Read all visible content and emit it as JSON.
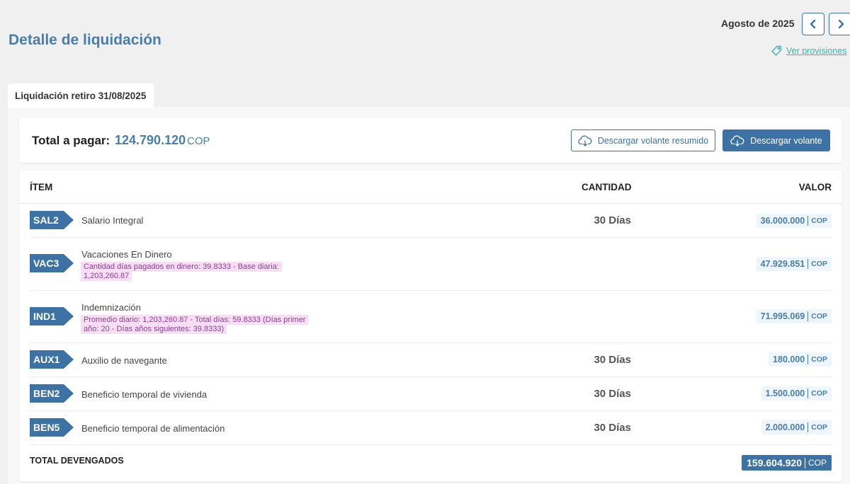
{
  "header": {
    "title": "Detalle de liquidación",
    "period": "Agosto de 2025",
    "provisions_link": "Ver provisiones"
  },
  "tab": {
    "label": "Liquidación retiro 31/08/2025"
  },
  "summary": {
    "total_label": "Total a pagar:",
    "total_amount": "124.790.120",
    "currency": "COP",
    "download_summary_label": "Descargar volante resumido",
    "download_label": "Descargar volante"
  },
  "table": {
    "headers": {
      "item": "ÍTEM",
      "quantity": "CANTIDAD",
      "value": "VALOR"
    },
    "rows": [
      {
        "code": "SAL2",
        "name": "Salario Integral",
        "detail": "",
        "quantity": "30 Días",
        "value": "36.000.000",
        "currency": "COP"
      },
      {
        "code": "VAC3",
        "name": "Vacaciones En Dinero",
        "detail": "Cantidad días pagados en dinero: 39.8333 - Base diaria: 1,203,260.87",
        "quantity": "",
        "value": "47.929.851",
        "currency": "COP"
      },
      {
        "code": "IND1",
        "name": "Indemnización",
        "detail": "Promedio diario: 1,203,260.87 - Total días: 59.8333 (Días primer año: 20 - Días años siguientes: 39.8333)",
        "quantity": "",
        "value": "71.995.069",
        "currency": "COP"
      },
      {
        "code": "AUX1",
        "name": "Auxilio de navegante",
        "detail": "",
        "quantity": "30 Días",
        "value": "180.000",
        "currency": "COP"
      },
      {
        "code": "BEN2",
        "name": "Beneficio temporal de vivienda",
        "detail": "",
        "quantity": "30 Días",
        "value": "1.500.000",
        "currency": "COP"
      },
      {
        "code": "BEN5",
        "name": "Beneficio temporal de alimentación",
        "detail": "",
        "quantity": "30 Días",
        "value": "2.000.000",
        "currency": "COP"
      }
    ],
    "total": {
      "label": "TOTAL DEVENGADOS",
      "value": "159.604.920",
      "currency": "COP"
    }
  },
  "colors": {
    "primary": "#3d72a4",
    "title": "#4a7ea8",
    "link": "#38b2ac",
    "detail_bg": "#f8def4",
    "detail_text": "#8a3f8f"
  },
  "icons": {
    "prev": "chevron-left-icon",
    "next": "chevron-right-icon",
    "provisions": "tag-icon",
    "download": "cloud-download-icon"
  }
}
